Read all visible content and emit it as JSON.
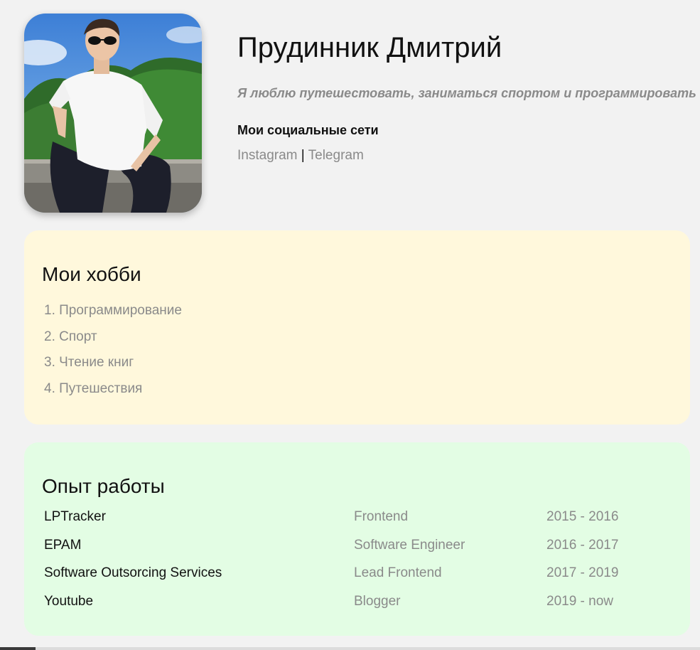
{
  "profile": {
    "name": "Прудинник Дмитрий",
    "tagline": "Я люблю путешестовать, заниматься спортом и программировать",
    "social_heading": "Мои социальные сети",
    "social_links": [
      {
        "label": "Instagram"
      },
      {
        "label": "Telegram"
      }
    ],
    "separator": "|"
  },
  "hobbies": {
    "title": "Мои хобби",
    "items": [
      "1. Программирование",
      "2. Спорт",
      "3. Чтение книг",
      "4. Путешествия"
    ]
  },
  "experience": {
    "title": "Опыт работы",
    "rows": [
      {
        "company": "LPTracker",
        "role": "Frontend",
        "years": "2015 - 2016"
      },
      {
        "company": "EPAM",
        "role": "Software Engineer",
        "years": "2016 - 2017"
      },
      {
        "company": "Software Outsorcing Services",
        "role": "Lead Frontend",
        "years": "2017 - 2019"
      },
      {
        "company": "Youtube",
        "role": "Blogger",
        "years": "2019 - now"
      }
    ]
  },
  "colors": {
    "page_bg": "#f2f2f2",
    "hobbies_bg": "#fff8dc",
    "experience_bg": "#e3fde4",
    "muted_text": "#8a8a8a",
    "primary_text": "#111111"
  }
}
